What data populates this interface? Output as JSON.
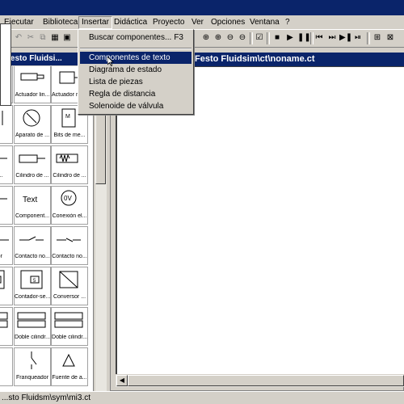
{
  "menubar": {
    "items": [
      "Ejecutar",
      "Biblioteca",
      "Insertar",
      "Didáctica",
      "Proyecto",
      "Ver",
      "Opciones",
      "Ventana",
      "?"
    ]
  },
  "insert_menu": {
    "items": [
      {
        "label": "Buscar componentes...",
        "accel": "F3"
      },
      {
        "label": "Componentes de texto",
        "accel": ""
      },
      {
        "label": "Diagrama de estado",
        "accel": ""
      },
      {
        "label": "Lista de piezas",
        "accel": ""
      },
      {
        "label": "Regla de distancia",
        "accel": ""
      },
      {
        "label": "Solenoide de válvula",
        "accel": ""
      }
    ],
    "highlighted_index": 1
  },
  "library": {
    "title": "\\Festo Fluidsi...",
    "tiles": [
      {
        "label": "",
        "icon": "actuator-left-icon"
      },
      {
        "label": "Actuador lin...",
        "icon": "linear-actuator-icon"
      },
      {
        "label": "Actuador rot...",
        "icon": "rotary-actuator-icon"
      },
      {
        "label": "",
        "icon": "sensor-icon"
      },
      {
        "label": "Aparato de ...",
        "icon": "gauge-icon"
      },
      {
        "label": "Bits de me...",
        "icon": "memory-bit-icon"
      },
      {
        "label": "...da ...",
        "icon": "cylinder-icon"
      },
      {
        "label": "Cilindro de ...",
        "icon": "cylinder-icon"
      },
      {
        "label": "Cilindro de ...",
        "icon": "cylinder-spring-icon"
      },
      {
        "label": "...al",
        "icon": "cylinder-icon"
      },
      {
        "label": "Component...",
        "icon": "text-component-icon"
      },
      {
        "label": "Conexión el...",
        "icon": "electric-connection-icon"
      },
      {
        "label": "...ador",
        "icon": "contact-icon"
      },
      {
        "label": "Contacto no...",
        "icon": "contact-no-icon"
      },
      {
        "label": "Contacto no...",
        "icon": "contact-nc-icon"
      },
      {
        "label": "",
        "icon": "counter-icon"
      },
      {
        "label": "Contador-se...",
        "icon": "counter-icon"
      },
      {
        "label": "Conversor ...",
        "icon": "converter-icon"
      },
      {
        "label": "",
        "icon": "double-cylinder-icon"
      },
      {
        "label": "Doble cilindr...",
        "icon": "double-cylinder-icon"
      },
      {
        "label": "Doble cilindr...",
        "icon": "double-cylinder-icon"
      },
      {
        "label": "...a",
        "icon": "switch-icon"
      },
      {
        "label": "Franqueador",
        "icon": "switch-icon"
      },
      {
        "label": "Fuente de a...",
        "icon": "source-icon"
      }
    ]
  },
  "document": {
    "title": "Festo Fluidsim\\ct\\noname.ct"
  },
  "status": {
    "text": "...sto Fluidsm\\sym\\mi3.ct"
  },
  "colors": {
    "title_active": "#0a246a",
    "face": "#d4d0c8",
    "canvas": "#ffffff"
  }
}
